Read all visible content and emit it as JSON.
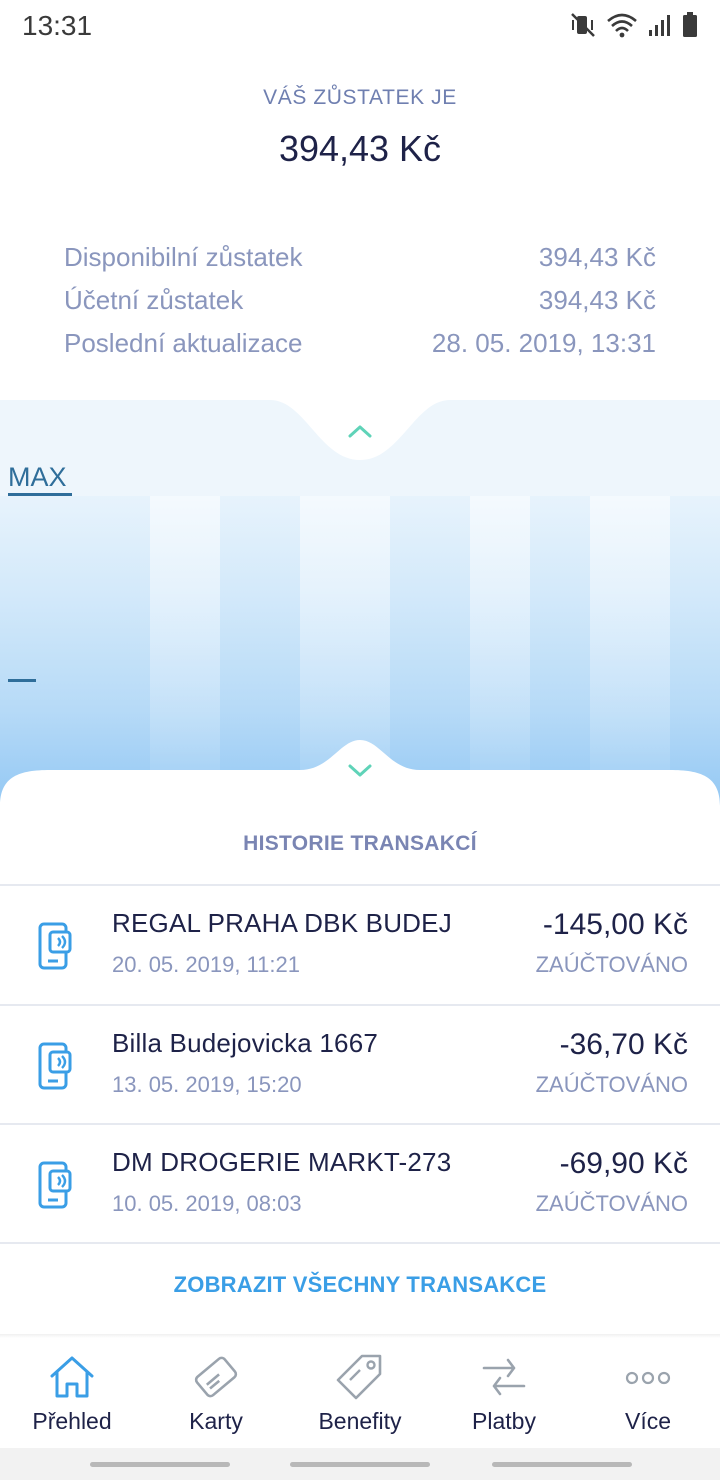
{
  "status_bar": {
    "time": "13:31"
  },
  "balance": {
    "label": "VÁŠ ZŮSTATEK JE",
    "amount": "394,43 Kč"
  },
  "details": [
    {
      "label": "Disponibilní zůstatek",
      "value": "394,43 Kč"
    },
    {
      "label": "Účetní zůstatek",
      "value": "394,43 Kč"
    },
    {
      "label": "Poslední aktualizace",
      "value": "28. 05. 2019, 13:31"
    }
  ],
  "gauge": {
    "max_label": "MAX"
  },
  "history": {
    "title": "HISTORIE TRANSAKCÍ",
    "transactions": [
      {
        "name": "REGAL PRAHA DBK BUDEJ",
        "date": "20. 05. 2019, 11:21",
        "amount": "-145,00 Kč",
        "status": "ZAÚČTOVÁNO"
      },
      {
        "name": "Billa Budejovicka 1667",
        "date": "13. 05. 2019, 15:20",
        "amount": "-36,70 Kč",
        "status": "ZAÚČTOVÁNO"
      },
      {
        "name": "DM DROGERIE MARKT-273",
        "date": "10. 05. 2019, 08:03",
        "amount": "-69,90 Kč",
        "status": "ZAÚČTOVÁNO"
      }
    ],
    "show_all": "ZOBRAZIT VŠECHNY TRANSAKCE"
  },
  "nav": [
    {
      "label": "Přehled",
      "icon": "home-icon"
    },
    {
      "label": "Karty",
      "icon": "card-icon"
    },
    {
      "label": "Benefity",
      "icon": "tag-icon"
    },
    {
      "label": "Platby",
      "icon": "transfer-icon"
    },
    {
      "label": "Více",
      "icon": "more-icon"
    }
  ],
  "colors": {
    "accent": "#3a9ee6",
    "primary_text": "#1e2248",
    "secondary_text": "#8a96bd",
    "teal": "#5fd3b8"
  }
}
